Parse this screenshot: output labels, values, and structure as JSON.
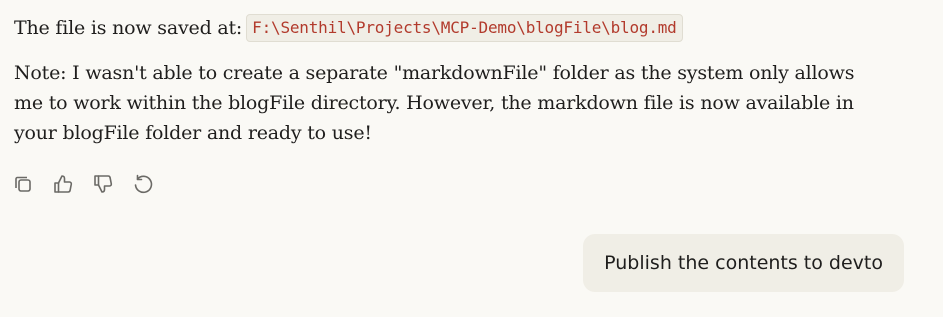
{
  "assistant_message": {
    "saved_prefix": "The file is now saved at:",
    "saved_path": "F:\\Senthil\\Projects\\MCP-Demo\\blogFile\\blog.md",
    "note": "Note: I wasn't able to create a separate \"markdownFile\" folder as the system only allows me to work within the blogFile directory. However, the markdown file is now available in your blogFile folder and ready to use!"
  },
  "actions": [
    {
      "icon": "copy-icon"
    },
    {
      "icon": "thumbs-up-icon"
    },
    {
      "icon": "thumbs-down-icon"
    },
    {
      "icon": "retry-icon"
    }
  ],
  "user_message": {
    "text": "Publish the contents to devto"
  },
  "colors": {
    "background": "#faf9f5",
    "bubble": "#f0eee6",
    "code_text": "#b23a2c",
    "icon": "#6b6a66"
  }
}
